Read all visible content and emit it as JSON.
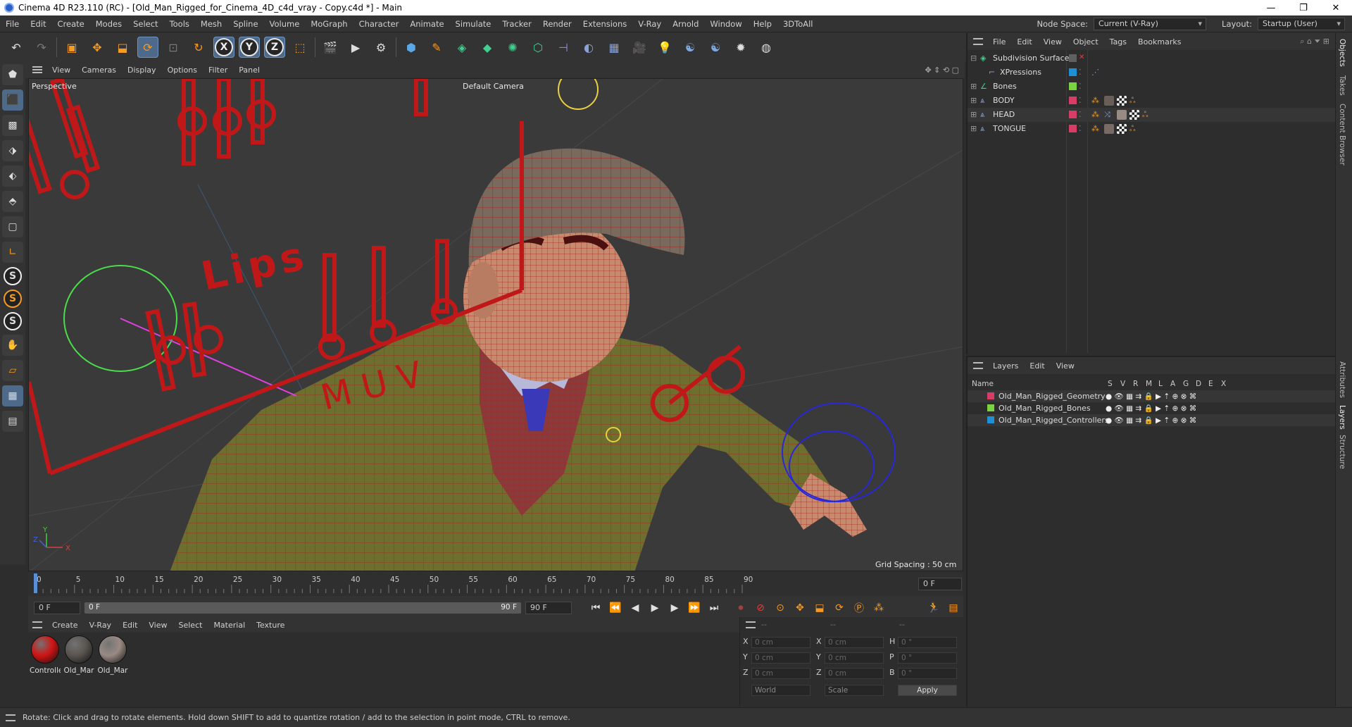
{
  "window": {
    "title": "Cinema 4D R23.110 (RC) - [Old_Man_Rigged_for_Cinema_4D_c4d_vray - Copy.c4d *] - Main",
    "minimize": "—",
    "maximize": "❐",
    "close": "✕"
  },
  "menubar": {
    "items": [
      "File",
      "Edit",
      "Create",
      "Modes",
      "Select",
      "Tools",
      "Mesh",
      "Spline",
      "Volume",
      "MoGraph",
      "Character",
      "Animate",
      "Simulate",
      "Tracker",
      "Render",
      "Extensions",
      "V-Ray",
      "Arnold",
      "Window",
      "Help",
      "3DToAll"
    ],
    "node_space_label": "Node Space:",
    "node_space_value": "Current (V-Ray)",
    "layout_label": "Layout:",
    "layout_value": "Startup (User)"
  },
  "toolbar": {
    "axis_x": "X",
    "axis_y": "Y",
    "axis_z": "Z"
  },
  "viewport": {
    "menu": [
      "View",
      "Cameras",
      "Display",
      "Options",
      "Filter",
      "Panel"
    ],
    "label": "Perspective",
    "camera": "Default Camera",
    "grid_spacing": "Grid Spacing : 50 cm",
    "lips_text": "Lips",
    "muv_text": "M U V",
    "axis_y": "Y",
    "axis_x": "X",
    "axis_z": "Z"
  },
  "timeline": {
    "ticks": [
      "0",
      "5",
      "10",
      "15",
      "20",
      "25",
      "30",
      "35",
      "40",
      "45",
      "50",
      "55",
      "60",
      "65",
      "70",
      "75",
      "80",
      "85",
      "90"
    ],
    "current_frame_right": "0 F"
  },
  "transport": {
    "start_frame": "0 F",
    "range_start": "0 F",
    "range_end": "90 F",
    "end_frame": "90 F"
  },
  "materials": {
    "menu": [
      "Create",
      "V-Ray",
      "Edit",
      "View",
      "Select",
      "Material",
      "Texture"
    ],
    "items": [
      {
        "name": "Controlle",
        "color": "#d11414"
      },
      {
        "name": "Old_Mar",
        "color": "#5a544f"
      },
      {
        "name": "Old_Mar",
        "color": "#9a8a84"
      }
    ]
  },
  "coordinates": {
    "header_a": "--",
    "header_b": "--",
    "header_c": "--",
    "rows": [
      {
        "a": "X",
        "av": "0 cm",
        "b": "X",
        "bv": "0 cm",
        "c": "H",
        "cv": "0 °"
      },
      {
        "a": "Y",
        "av": "0 cm",
        "b": "Y",
        "bv": "0 cm",
        "c": "P",
        "cv": "0 °"
      },
      {
        "a": "Z",
        "av": "0 cm",
        "b": "Z",
        "bv": "0 cm",
        "c": "B",
        "cv": "0 °"
      }
    ],
    "mode_world": "World",
    "mode_scale": "Scale",
    "apply": "Apply"
  },
  "status": {
    "text": "Rotate: Click and drag to rotate elements. Hold down SHIFT to add to quantize rotation / add to the selection in point mode, CTRL to remove."
  },
  "object_manager": {
    "menu": [
      "File",
      "Edit",
      "View",
      "Object",
      "Tags",
      "Bookmarks"
    ],
    "objects": [
      {
        "name": "Subdivision Surface",
        "color": "#5f6060"
      },
      {
        "name": "XPressions",
        "color": "#1f8fd6"
      },
      {
        "name": "Bones",
        "color": "#7bd33f"
      },
      {
        "name": "BODY",
        "color": "#d93c64"
      },
      {
        "name": "HEAD",
        "color": "#d93c64"
      },
      {
        "name": "TONGUE",
        "color": "#d93c64"
      }
    ]
  },
  "layer_manager": {
    "menu": [
      "Layers",
      "Edit",
      "View"
    ],
    "header_name": "Name",
    "columns": [
      "S",
      "V",
      "R",
      "M",
      "L",
      "A",
      "G",
      "D",
      "E",
      "X"
    ],
    "layers": [
      {
        "name": "Old_Man_Rigged_Geometry",
        "color": "#d93c64"
      },
      {
        "name": "Old_Man_Rigged_Bones",
        "color": "#7bd33f"
      },
      {
        "name": "Old_Man_Rigged_Controllers",
        "color": "#1f8fd6"
      }
    ]
  },
  "side_tabs": [
    "Objects",
    "Takes",
    "Content Browser",
    "Attributes",
    "Layers",
    "Structure"
  ]
}
